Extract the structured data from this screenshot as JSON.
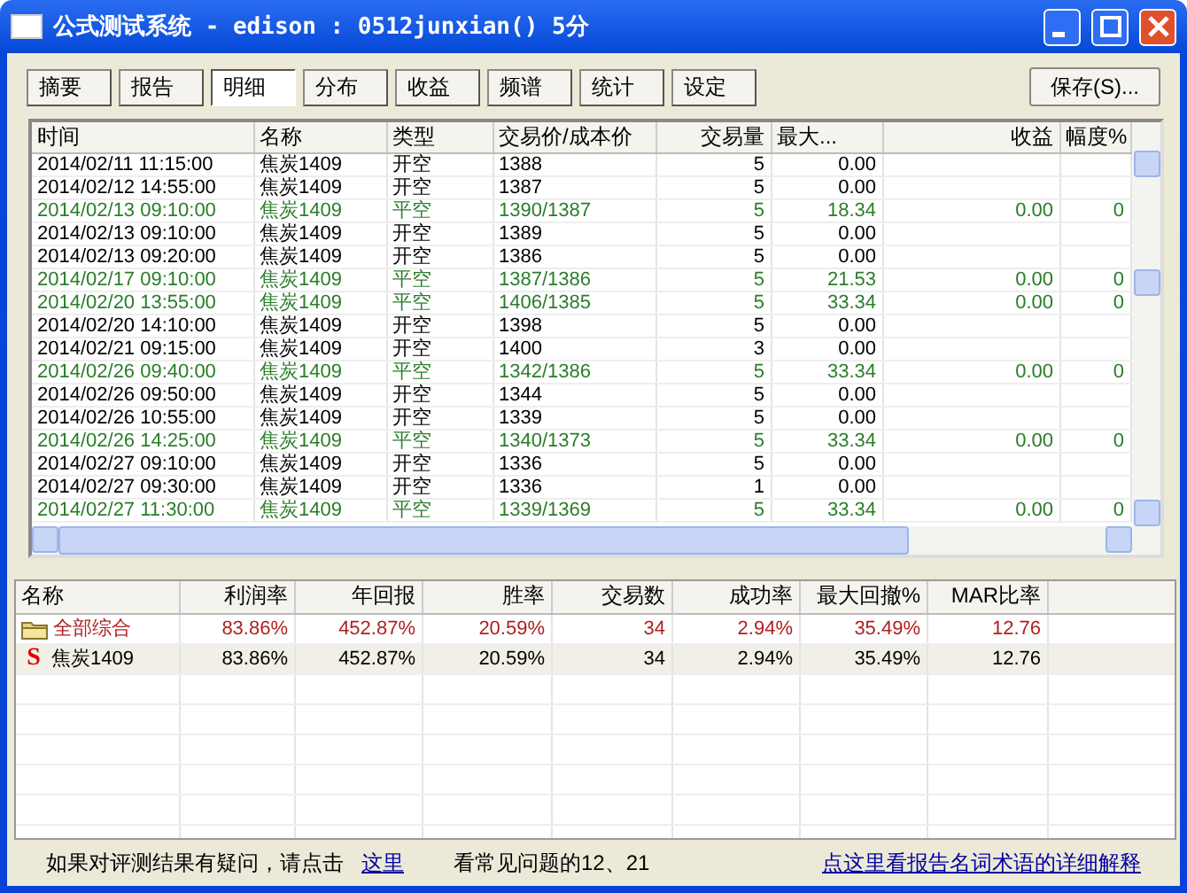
{
  "window": {
    "title": "公式测试系统 - edison : 0512junxian() 5分"
  },
  "tabs": [
    {
      "label": "摘要",
      "selected": false
    },
    {
      "label": "报告",
      "selected": false
    },
    {
      "label": "明细",
      "selected": true
    },
    {
      "label": "分布",
      "selected": false
    },
    {
      "label": "收益",
      "selected": false
    },
    {
      "label": "频谱",
      "selected": false
    },
    {
      "label": "统计",
      "selected": false
    },
    {
      "label": "设定",
      "selected": false
    }
  ],
  "save_button": "保存(S)...",
  "trades": {
    "columns": [
      "时间",
      "名称",
      "类型",
      "交易价/成本价",
      "交易量",
      "最大...",
      "收益",
      "幅度%"
    ],
    "rows": [
      {
        "kind": "open",
        "cells": [
          "2014/02/11 11:15:00",
          "焦炭1409",
          "开空",
          "1388",
          "5",
          "0.00",
          "",
          ""
        ]
      },
      {
        "kind": "open",
        "cells": [
          "2014/02/12 14:55:00",
          "焦炭1409",
          "开空",
          "1387",
          "5",
          "0.00",
          "",
          ""
        ]
      },
      {
        "kind": "close",
        "cells": [
          "2014/02/13 09:10:00",
          "焦炭1409",
          "平空",
          "1390/1387",
          "5",
          "18.34",
          "0.00",
          "0"
        ]
      },
      {
        "kind": "open",
        "cells": [
          "2014/02/13 09:10:00",
          "焦炭1409",
          "开空",
          "1389",
          "5",
          "0.00",
          "",
          ""
        ]
      },
      {
        "kind": "open",
        "cells": [
          "2014/02/13 09:20:00",
          "焦炭1409",
          "开空",
          "1386",
          "5",
          "0.00",
          "",
          ""
        ]
      },
      {
        "kind": "close",
        "cells": [
          "2014/02/17 09:10:00",
          "焦炭1409",
          "平空",
          "1387/1386",
          "5",
          "21.53",
          "0.00",
          "0"
        ]
      },
      {
        "kind": "close",
        "cells": [
          "2014/02/20 13:55:00",
          "焦炭1409",
          "平空",
          "1406/1385",
          "5",
          "33.34",
          "0.00",
          "0"
        ]
      },
      {
        "kind": "open",
        "cells": [
          "2014/02/20 14:10:00",
          "焦炭1409",
          "开空",
          "1398",
          "5",
          "0.00",
          "",
          ""
        ]
      },
      {
        "kind": "open",
        "cells": [
          "2014/02/21 09:15:00",
          "焦炭1409",
          "开空",
          "1400",
          "3",
          "0.00",
          "",
          ""
        ]
      },
      {
        "kind": "close",
        "cells": [
          "2014/02/26 09:40:00",
          "焦炭1409",
          "平空",
          "1342/1386",
          "5",
          "33.34",
          "0.00",
          "0"
        ]
      },
      {
        "kind": "open",
        "cells": [
          "2014/02/26 09:50:00",
          "焦炭1409",
          "开空",
          "1344",
          "5",
          "0.00",
          "",
          ""
        ]
      },
      {
        "kind": "open",
        "cells": [
          "2014/02/26 10:55:00",
          "焦炭1409",
          "开空",
          "1339",
          "5",
          "0.00",
          "",
          ""
        ]
      },
      {
        "kind": "close",
        "cells": [
          "2014/02/26 14:25:00",
          "焦炭1409",
          "平空",
          "1340/1373",
          "5",
          "33.34",
          "0.00",
          "0"
        ]
      },
      {
        "kind": "open",
        "cells": [
          "2014/02/27 09:10:00",
          "焦炭1409",
          "开空",
          "1336",
          "5",
          "0.00",
          "",
          ""
        ]
      },
      {
        "kind": "open",
        "cells": [
          "2014/02/27 09:30:00",
          "焦炭1409",
          "开空",
          "1336",
          "1",
          "0.00",
          "",
          ""
        ]
      },
      {
        "kind": "close",
        "cells": [
          "2014/02/27 11:30:00",
          "焦炭1409",
          "平空",
          "1339/1369",
          "5",
          "33.34",
          "0.00",
          "0"
        ]
      }
    ]
  },
  "summary": {
    "columns": [
      "名称",
      "利润率",
      "年回报",
      "胜率",
      "交易数",
      "成功率",
      "最大回撤%",
      "MAR比率"
    ],
    "rows": [
      {
        "kind": "group",
        "cells": [
          "全部综合",
          "83.86%",
          "452.87%",
          "20.59%",
          "34",
          "2.94%",
          "35.49%",
          "12.76"
        ]
      },
      {
        "kind": "symbol",
        "marker": "S",
        "cells": [
          "焦炭1409",
          "83.86%",
          "452.87%",
          "20.59%",
          "34",
          "2.94%",
          "35.49%",
          "12.76"
        ]
      }
    ]
  },
  "status_bar": {
    "prompt": "如果对评测结果有疑问，请点击",
    "link": "这里",
    "faq": "看常见问题的12、21",
    "glossary_link": "点这里看报告名词术语的详细解释"
  }
}
